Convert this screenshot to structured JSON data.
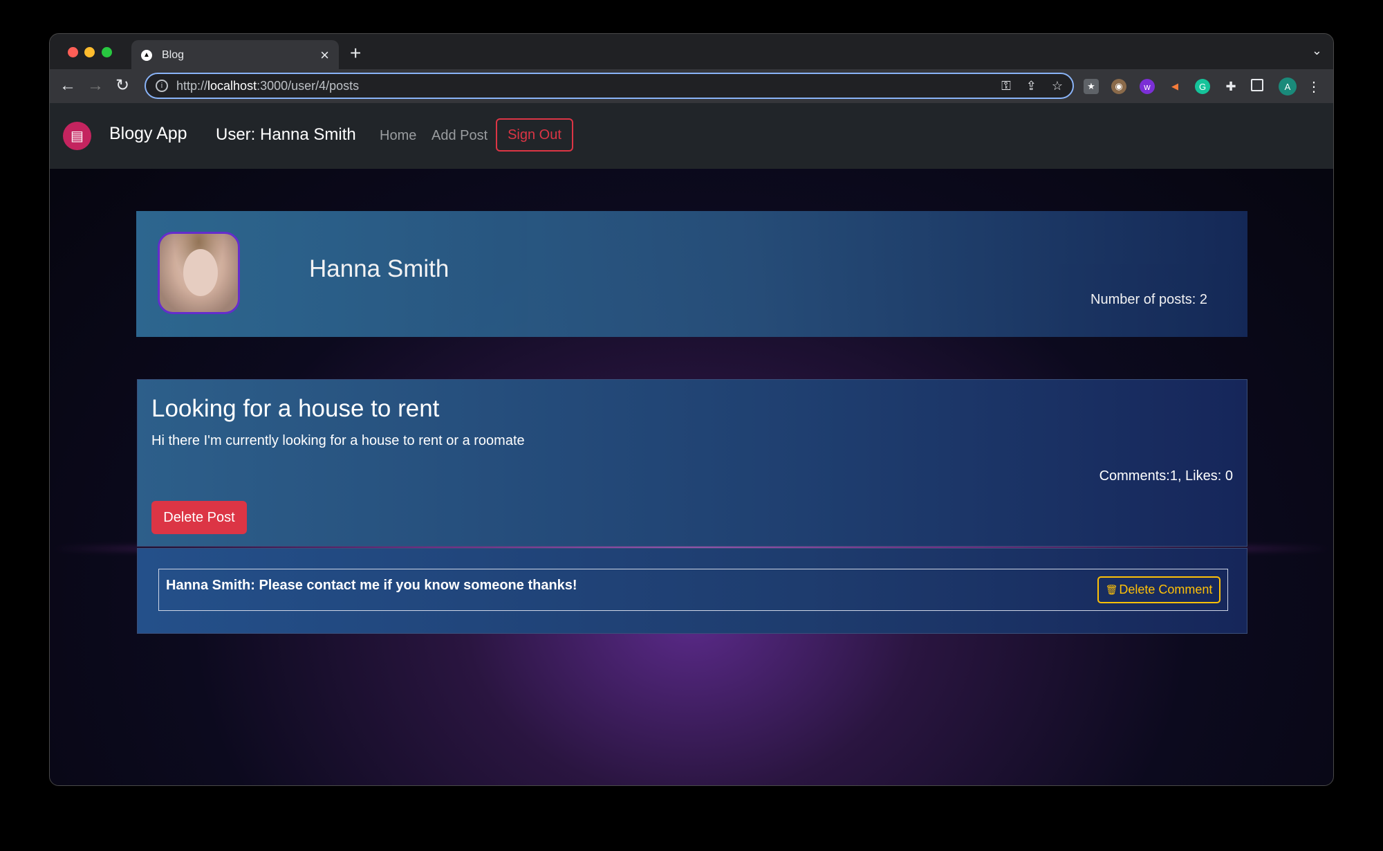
{
  "browser": {
    "tab_title": "Blog",
    "favicon": "▲",
    "url_prefix": "http://",
    "url_host": "localhost",
    "url_path": ":3000/user/4/posts",
    "extension_avatar": "A"
  },
  "navbar": {
    "brand": "Blogy App",
    "user_label": "User: Hanna Smith",
    "home_label": "Home",
    "add_post_label": "Add Post",
    "sign_out_label": "Sign Out"
  },
  "profile": {
    "name": "Hanna Smith",
    "post_count": "Number of posts: 2"
  },
  "post": {
    "title": "Looking for a house to rent",
    "body": "Hi there I'm currently looking for a house to rent or a roomate",
    "stats": "Comments:1, Likes: 0",
    "delete_label": "Delete Post"
  },
  "comment": {
    "text": "Hanna Smith: Please contact me if you know someone thanks!",
    "delete_label": "Delete Comment"
  },
  "colors": {
    "accent_danger": "#dc3545",
    "accent_warning": "#ffc107",
    "navbar_bg": "#212529"
  }
}
